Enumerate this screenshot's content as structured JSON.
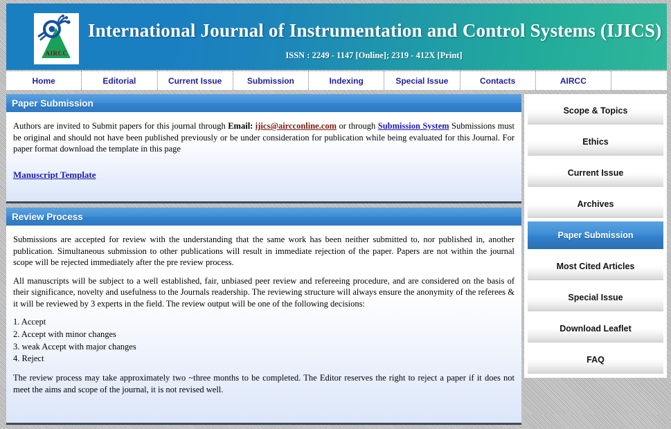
{
  "header": {
    "title": "International Journal of Instrumentation and Control Systems (IJICS)",
    "issn": "ISSN : 2249 - 1147 [Online]; 2319 - 412X [Print]",
    "logo_text": "AIRCC",
    "gradient_start": "#1a7fc1",
    "gradient_end": "#2fb79a"
  },
  "nav": {
    "items": [
      {
        "label": "Home"
      },
      {
        "label": "Editorial"
      },
      {
        "label": "Current Issue"
      },
      {
        "label": "Submission"
      },
      {
        "label": "Indexing"
      },
      {
        "label": "Special Issue"
      },
      {
        "label": "Contacts"
      },
      {
        "label": "AIRCC"
      }
    ],
    "text_color": "#1f1f9e"
  },
  "paper_submission": {
    "title": "Paper Submission",
    "intro_part1": "Authors are invited to Submit papers for this journal through ",
    "email_label": "Email:",
    "email_link": "ijics@aircconline.com",
    "intro_part2": " or through ",
    "submission_system_link": "Submission System",
    "intro_part3": " Submissions must be original and should not have been published previously or be under consideration for publication while being evaluated for this Journal. For paper format download the template in this page",
    "template_link": "Manuscript Template"
  },
  "review_process": {
    "title": "Review Process",
    "paragraph1": "Submissions are accepted for review with the understanding that the same work has been neither submitted to, nor published in, another publication. Simultaneous submission to other publications will result in immediate rejection of the paper. Papers are not within the journal scope will be rejected immediately after the pre review process.",
    "paragraph2": "All manuscripts will be subject to a well established, fair, unbiased peer review and refereeing procedure, and are considered on the basis of their significance, novelty and usefulness to the Journals readership. The reviewing structure will always ensure the anonymity of the referees & it will be reviewed by 3 experts in the field. The review output will be one of the following decisions:",
    "decisions": [
      "1. Accept",
      "2. Accept with minor changes",
      "3. weak Accept with major changes",
      "4. Reject"
    ],
    "paragraph3": "The review process may take approximately two ~three months to be completed. The Editor reserves the right to reject a paper if it does not meet the aims and scope of the journal, it is not revised well."
  },
  "sidebar": {
    "active_index": 4,
    "items": [
      {
        "label": "Scope & Topics"
      },
      {
        "label": "Ethics"
      },
      {
        "label": "Current Issue"
      },
      {
        "label": "Archives"
      },
      {
        "label": "Paper Submission"
      },
      {
        "label": "Most Cited Articles"
      },
      {
        "label": "Special Issue"
      },
      {
        "label": "Download Leaflet"
      },
      {
        "label": "FAQ"
      }
    ],
    "active_bg": "#3484cf"
  }
}
